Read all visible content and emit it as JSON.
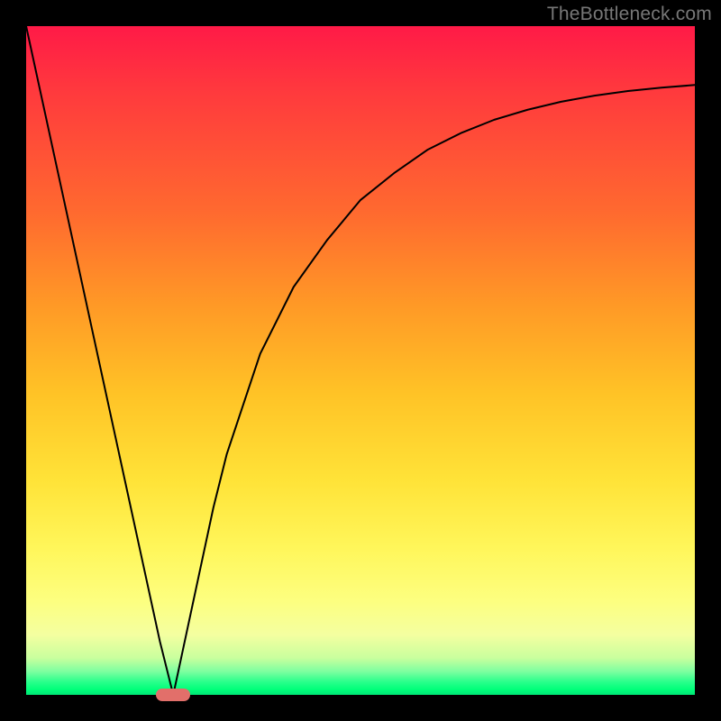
{
  "attribution": "TheBottleneck.com",
  "chart_data": {
    "type": "line",
    "title": "",
    "xlabel": "",
    "ylabel": "",
    "xlim": [
      0,
      100
    ],
    "ylim": [
      0,
      100
    ],
    "grid": false,
    "legend": false,
    "series": [
      {
        "name": "curve",
        "x": [
          0,
          5,
          10,
          15,
          20,
          22,
          25,
          28,
          30,
          35,
          40,
          45,
          50,
          55,
          60,
          65,
          70,
          75,
          80,
          85,
          90,
          95,
          100
        ],
        "y": [
          100,
          77,
          54,
          31,
          8,
          0,
          14,
          28,
          36,
          51,
          61,
          68,
          74,
          78,
          81.5,
          84,
          86,
          87.5,
          88.7,
          89.6,
          90.3,
          90.8,
          91.2
        ]
      }
    ],
    "marker": {
      "x": 22,
      "y": 0
    }
  },
  "colors": {
    "frame": "#000000",
    "curve": "#000000",
    "marker": "#e26f6a",
    "attribution": "#777777"
  }
}
